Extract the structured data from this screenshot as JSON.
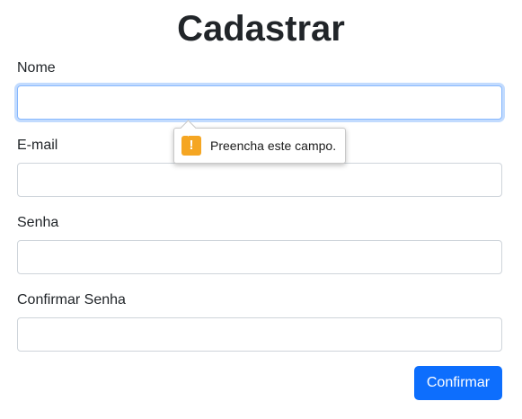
{
  "form": {
    "title": "Cadastrar",
    "fields": [
      {
        "label": "Nome",
        "value": "",
        "placeholder": ""
      },
      {
        "label": "E-mail",
        "value": "",
        "placeholder": ""
      },
      {
        "label": "Senha",
        "value": "",
        "placeholder": ""
      },
      {
        "label": "Confirmar Senha",
        "value": "",
        "placeholder": ""
      }
    ],
    "submit_label": "Confirmar"
  },
  "validation_tooltip": {
    "icon": "warning-icon",
    "icon_glyph": "!",
    "message": "Preencha este campo."
  },
  "colors": {
    "primary": "#0d6efd",
    "focus_border": "#86b7fe",
    "warning": "#f5a623"
  }
}
